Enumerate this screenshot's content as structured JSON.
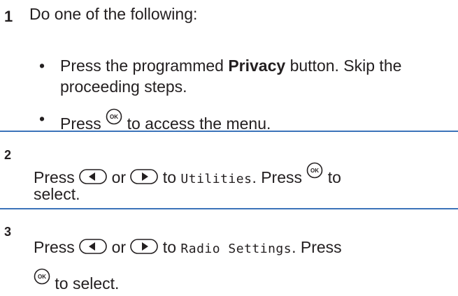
{
  "steps": [
    {
      "number": "1",
      "intro": "Do one of the following:",
      "bullet1": {
        "pre": "Press the programmed ",
        "bold": "Privacy",
        "post": " button. Skip the",
        "line2": "proceeding steps."
      },
      "bullet2": {
        "pre": "Press ",
        "post": " to access the menu."
      }
    },
    {
      "number": "2",
      "press": "Press ",
      "or": " or ",
      "to": " to ",
      "target": "Utilities",
      "after": ". Press ",
      "to2": " to",
      "line2": "select."
    },
    {
      "number": "3",
      "press": "Press ",
      "or": " or ",
      "to": " to ",
      "target": "Radio Settings",
      "after": ". Press",
      "line2": " to select."
    }
  ],
  "icons": {
    "ok": "ok-button-icon",
    "left": "left-navigation-button-icon",
    "right": "right-navigation-button-icon",
    "ok_label": "OK"
  },
  "colors": {
    "divider": "#3b73b9",
    "text": "#231f20"
  }
}
